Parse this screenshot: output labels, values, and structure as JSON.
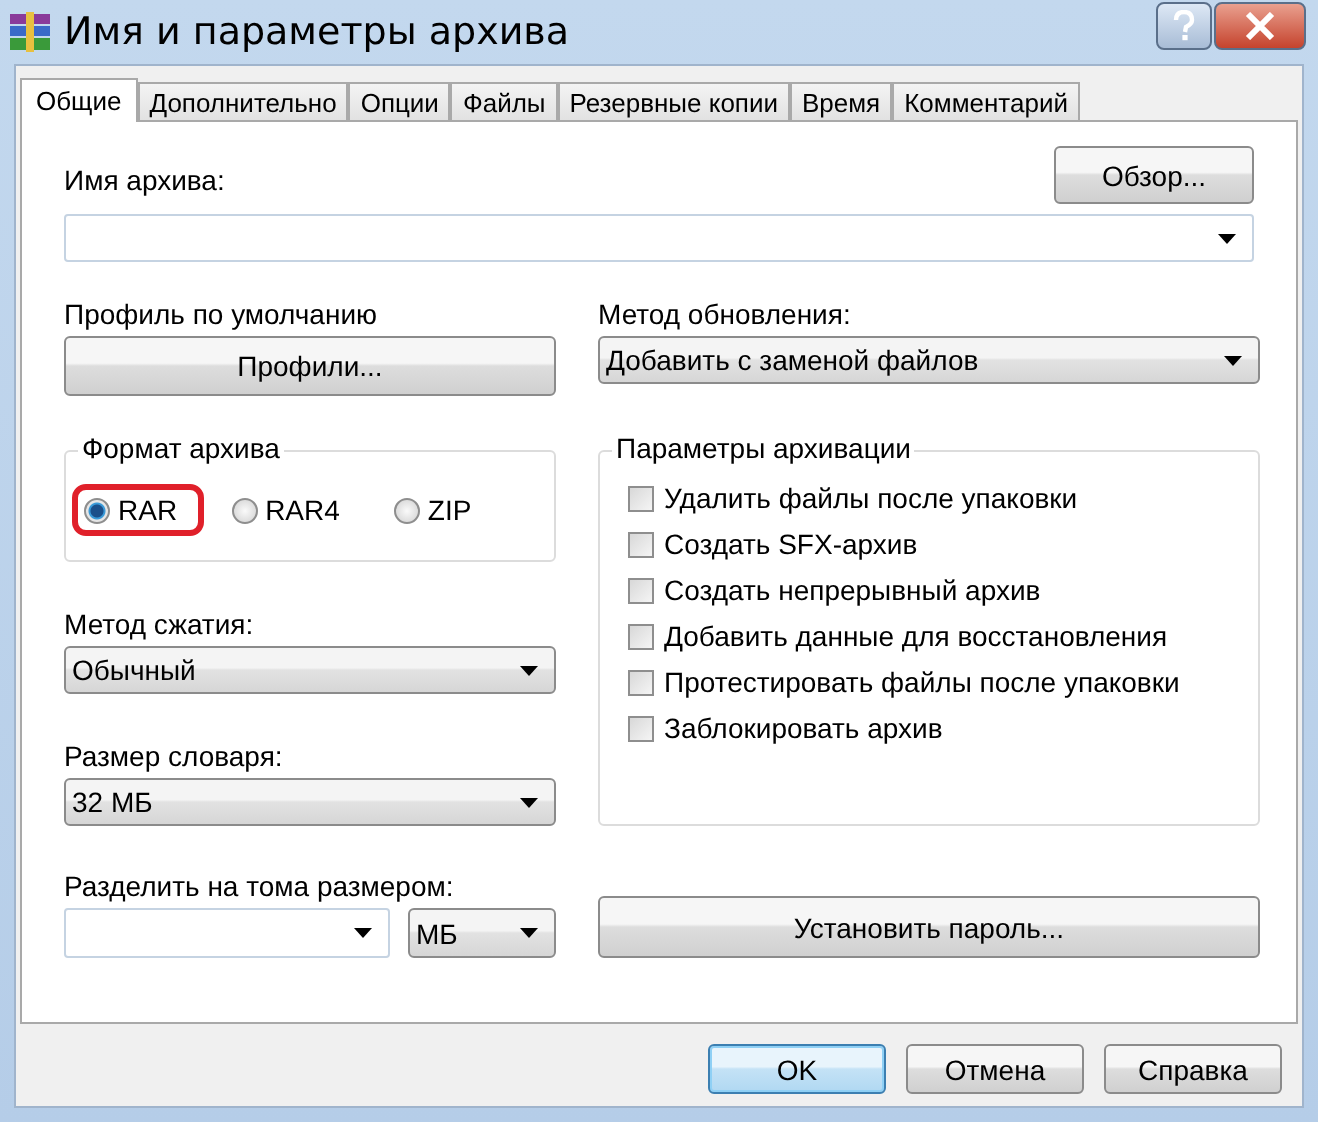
{
  "window": {
    "title": "Имя и параметры архива"
  },
  "tabs": [
    {
      "label": "Общие",
      "selected": true
    },
    {
      "label": "Дополнительно",
      "selected": false
    },
    {
      "label": "Опции",
      "selected": false
    },
    {
      "label": "Файлы",
      "selected": false
    },
    {
      "label": "Резервные копии",
      "selected": false
    },
    {
      "label": "Время",
      "selected": false
    },
    {
      "label": "Комментарий",
      "selected": false
    }
  ],
  "archive_name": {
    "label": "Имя архива:",
    "browse_button": "Обзор..."
  },
  "profile": {
    "label": "Профиль по умолчанию",
    "button": "Профили..."
  },
  "update_method": {
    "label": "Метод обновления:",
    "value": "Добавить с заменой файлов"
  },
  "archive_format": {
    "title": "Формат архива",
    "options": [
      {
        "label": "RAR",
        "selected": true,
        "annotation": {
          "kind": "outline",
          "color": "#e0202a"
        }
      },
      {
        "label": "RAR4",
        "selected": false
      },
      {
        "label": "ZIP",
        "selected": false
      }
    ]
  },
  "compression_method": {
    "label": "Метод сжатия:",
    "value": "Обычный"
  },
  "dictionary_size": {
    "label": "Размер словаря:",
    "value": "32 МБ"
  },
  "archiving_options": {
    "title": "Параметры архивации",
    "items": [
      {
        "label": "Удалить файлы после упаковки",
        "checked": false
      },
      {
        "label": "Создать SFX-архив",
        "checked": false
      },
      {
        "label": "Создать непрерывный архив",
        "checked": false
      },
      {
        "label": "Добавить данные для восстановления",
        "checked": false
      },
      {
        "label": "Протестировать файлы после упаковки",
        "checked": false
      },
      {
        "label": "Заблокировать архив",
        "checked": false
      }
    ]
  },
  "split_volumes": {
    "label": "Разделить на тома размером:",
    "unit": "МБ"
  },
  "set_password_button": "Установить пароль...",
  "buttons": [
    {
      "label": "OK",
      "default": true
    },
    {
      "label": "Отмена",
      "default": false
    },
    {
      "label": "Справка",
      "default": false
    }
  ]
}
